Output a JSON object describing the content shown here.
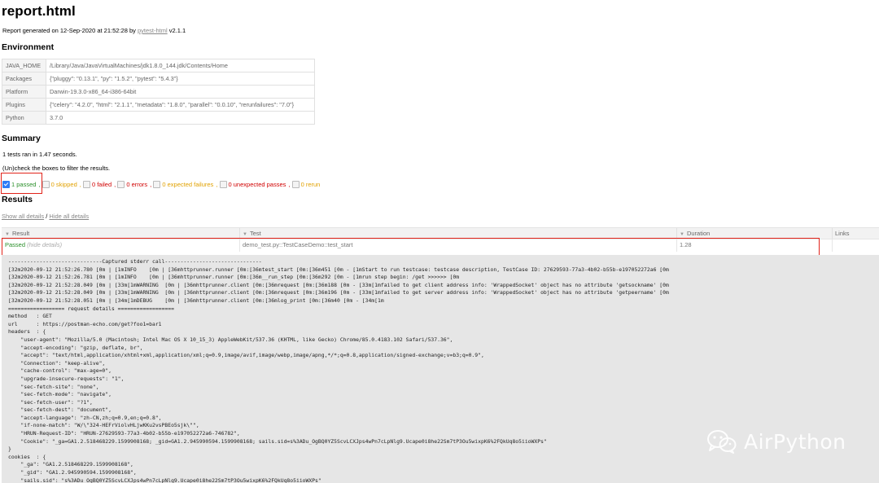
{
  "report": {
    "title": "report.html",
    "generated_prefix": "Report generated on 12-Sep-2020 at 21:52:28 by",
    "generated_link": "pytest-html",
    "generated_version": "v2.1.1"
  },
  "environment": {
    "heading": "Environment",
    "rows": [
      {
        "key": "JAVA_HOME",
        "value": "/Library/Java/JavaVirtualMachines/jdk1.8.0_144.jdk/Contents/Home"
      },
      {
        "key": "Packages",
        "value": "{\"pluggy\": \"0.13.1\", \"py\": \"1.5.2\", \"pytest\": \"5.4.3\"}"
      },
      {
        "key": "Platform",
        "value": "Darwin-19.3.0-x86_64-i386-64bit"
      },
      {
        "key": "Plugins",
        "value": "{\"celery\": \"4.2.0\", \"html\": \"2.1.1\", \"metadata\": \"1.8.0\", \"parallel\": \"0.0.10\", \"rerunfailures\": \"7.0\"}"
      },
      {
        "key": "Python",
        "value": "3.7.0"
      }
    ]
  },
  "summary": {
    "heading": "Summary",
    "tests_ran": "1 tests ran in 1.47 seconds.",
    "filter_hint": "(Un)check the boxes to filter the results.",
    "filters": [
      {
        "label": "1 passed",
        "checked": true,
        "color": "#2a8f2a"
      },
      {
        "label": "0 skipped",
        "checked": false,
        "color": "#e1a100"
      },
      {
        "label": "0 failed",
        "checked": false,
        "color": "#d00000"
      },
      {
        "label": "0 errors",
        "checked": false,
        "color": "#d00000"
      },
      {
        "label": "0 expected failures",
        "checked": false,
        "color": "#e1a100"
      },
      {
        "label": "0 unexpected passes",
        "checked": false,
        "color": "#d00000"
      },
      {
        "label": "0 rerun",
        "checked": false,
        "color": "#e1a100"
      }
    ]
  },
  "results": {
    "heading": "Results",
    "show_all": "Show all details",
    "slash": "/",
    "hide_all": "Hide all details",
    "columns": {
      "result": "Result",
      "test": "Test",
      "duration": "Duration",
      "links": "Links"
    },
    "row": {
      "result": "Passed",
      "hide_details": "(hide details)",
      "test": "demo_test.py::TestCaseDemo::test_start",
      "duration": "1.28",
      "links": ""
    },
    "log": "------------------------------Captured stderr call-------------------------------\n[32m2020-09-12 21:52:26.780 [0m | [1mINFO    [0m | [36mhttprunner.runner [0m:[36mtest_start [0m:[36m451 [0m - [1mStart to run testcase: testcase description, TestCase ID: 27629593-77a3-4b02-b55b-e197052272a6 [0m\n[32m2020-09-12 21:52:26.781 [0m | [1mINFO    [0m | [36mhttprunner.runner [0m:[36m__run_step [0m:[36m292 [0m - [1mrun step begin: /get >>>>>> [0m\n[32m2020-09-12 21:52:28.049 [0m | [33m[1mWARNING  [0m | [36mhttprunner.client [0m:[36mrequest [0m:[36m188 [0m - [33m[1mfailed to get client address info: 'WrappedSocket' object has no attribute 'getsockname' [0m\n[32m2020-09-12 21:52:28.049 [0m | [33m[1mWARNING  [0m | [36mhttprunner.client [0m:[36mrequest [0m:[36m196 [0m - [33m[1mfailed to get server address info: 'WrappedSocket' object has no attribute 'getpeername' [0m\n[32m2020-09-12 21:52:28.051 [0m | [34m[1mDEBUG    [0m | [36mhttprunner.client [0m:[36mlog_print [0m:[36m40 [0m - [34m[1m\n================== request details ==================\nmethod   : GET\nurl      : https://postman-echo.com/get?foo1=bar1\nheaders  : {\n    \"user-agent\": \"Mozilla/5.0 (Macintosh; Intel Mac OS X 10_15_3) AppleWebKit/537.36 (KHTML, like Gecko) Chrome/85.0.4183.102 Safari/537.36\",\n    \"accept-encoding\": \"gzip, deflate, br\",\n    \"accept\": \"text/html,application/xhtml+xml,application/xml;q=0.9,image/avif,image/webp,image/apng,*/*;q=0.8,application/signed-exchange;v=b3;q=0.9\",\n    \"Connection\": \"keep-alive\",\n    \"cache-control\": \"max-age=0\",\n    \"upgrade-insecure-requests\": \"1\",\n    \"sec-fetch-site\": \"none\",\n    \"sec-fetch-mode\": \"navigate\",\n    \"sec-fetch-user\": \"?1\",\n    \"sec-fetch-dest\": \"document\",\n    \"accept-language\": \"zh-CN,zh;q=0.9,en;q=0.8\",\n    \"if-none-match\": \"W/\\\"324-HEFrViolvHLjwKKu2vsPBEo5sjk\\\"\",\n    \"HRUN-Request-ID\": \"HRUN-27629593-77a3-4b02-b55b-e197052272a6-746782\",\n    \"Cookie\": \"_ga=GA1.2.518468229.1599908168; _gid=GA1.2.945990594.1599908168; sails.sid=s%3ADu_OgBQ0YZ5ScvLCXJps4wPn7cLpNlg9.Ucape0i8he22Sm7tP3Ou5wixpK6%2FQkUq8o5iioWXPs\"\n}\ncookies  : {\n    \"_ga\": \"GA1.2.518468229.1599908168\",\n    \"_gid\": \"GA1.2.945990594.1599908168\",\n    \"sails.sid\": \"s%3ADu_OgBQ0YZ5ScvLCXJps4wPn7cLpNlg9.Ucape0i8he22Sm7tP3Ou5wixpK6%2FQkUq8o5iioWXPs\""
  },
  "watermark": {
    "text": "AirPython",
    "icon": "wechat-icon"
  }
}
